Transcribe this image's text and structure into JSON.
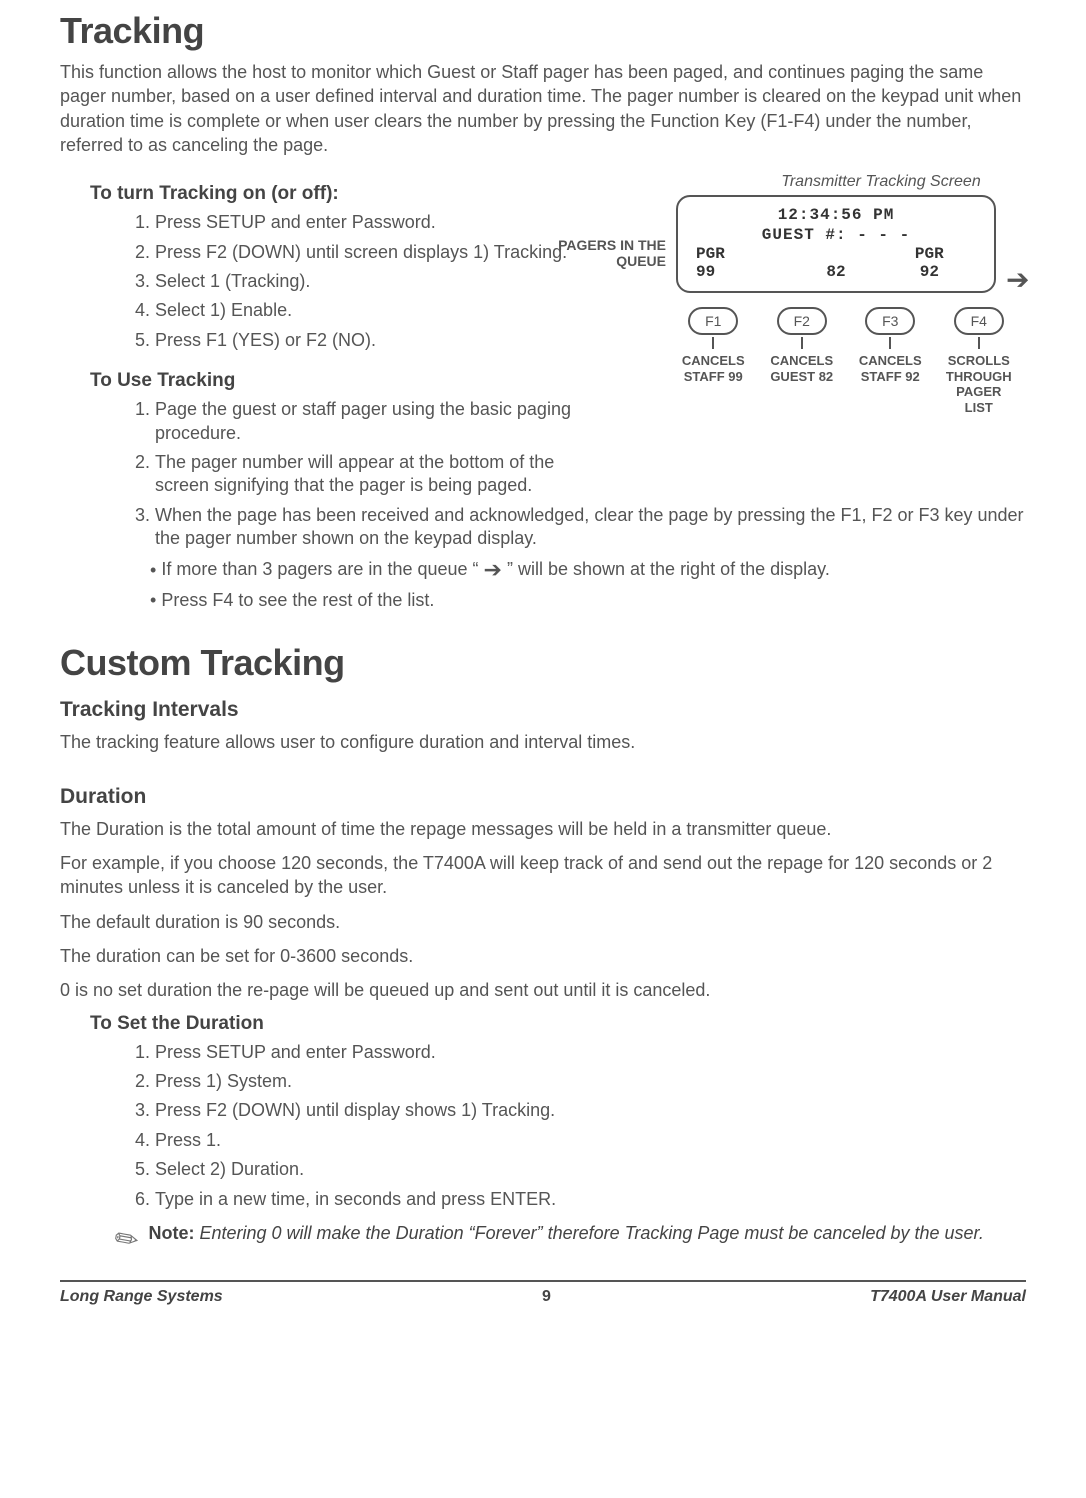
{
  "title_tracking": "Tracking",
  "tracking_intro": "This function allows the host to monitor which Guest or Staff pager has been paged, and continues paging the same pager number, based on a user defined interval and duration time. The pager number is cleared on the keypad unit when duration time is complete or when user clears the number by pressing the Function Key (F1-F4) under the number, referred to as canceling the page.",
  "turn_heading": "To turn Tracking on (or off):",
  "turn_steps": [
    "Press SETUP and enter Password.",
    "Press F2 (DOWN) until screen displays 1) Tracking.",
    "Select 1 (Tracking).",
    "Select 1) Enable.",
    "Press F1 (YES) or F2 (NO)."
  ],
  "use_heading": "To Use Tracking",
  "use_steps": [
    "Page the guest or staff pager using the basic paging procedure.",
    "The pager number will appear at the bottom of the screen signifying that the pager is being paged.",
    "When the page has been received and acknowledged, clear the page by pressing the F1, F2 or F3 key under the pager number shown on the keypad display."
  ],
  "use_sub_a": "If more than 3 pagers are in the queue  “",
  "use_sub_a2": "” will be shown at the right of the display.",
  "use_sub_b": "Press F4 to see the rest of the list.",
  "screen": {
    "caption": "Transmitter Tracking Screen",
    "queue_label": "PAGERS IN THE QUEUE",
    "time": "12:34:56 PM",
    "guest_line": "GUEST #: - - -",
    "col1_h": "PGR",
    "col3_h": "PGR",
    "val1": "99",
    "val2": "82",
    "val3": "92",
    "f1": "F1",
    "f2": "F2",
    "f3": "F3",
    "f4": "F4",
    "f1_label": "CANCELS STAFF 99",
    "f2_label": "CANCELS GUEST 82",
    "f3_label": "CANCELS STAFF 92",
    "f4_label": "SCROLLS THROUGH PAGER LIST"
  },
  "title_custom": "Custom Tracking",
  "intervals_heading": "Tracking Intervals",
  "intervals_p": "The tracking feature allows user to configure duration and interval times.",
  "duration_heading": "Duration",
  "duration_p1": "The Duration is the total amount of time the repage messages will be held in a transmitter queue.",
  "duration_p2": "For example, if you choose 120 seconds, the T7400A will keep track of and send out the repage for 120 seconds or 2 minutes unless it is canceled by the user.",
  "duration_p3": "The default duration is 90 seconds.",
  "duration_p4": "The duration can be set for 0-3600 seconds.",
  "duration_p5": "0 is no set duration the re-page will be queued up and sent out until it is canceled.",
  "set_duration_heading": "To Set the Duration",
  "set_duration_steps": [
    "Press SETUP and enter Password.",
    "Press 1) System.",
    "Press F2 (DOWN) until display shows 1) Tracking.",
    "Press 1.",
    "Select 2) Duration.",
    "Type in a new time, in seconds and press ENTER."
  ],
  "note_label": "Note:",
  "note_body": "Entering 0 will make the Duration “Forever” therefore  Tracking Page must be canceled by the user.",
  "footer_left": "Long Range Systems",
  "footer_center": "9",
  "footer_right": "T7400A User Manual"
}
